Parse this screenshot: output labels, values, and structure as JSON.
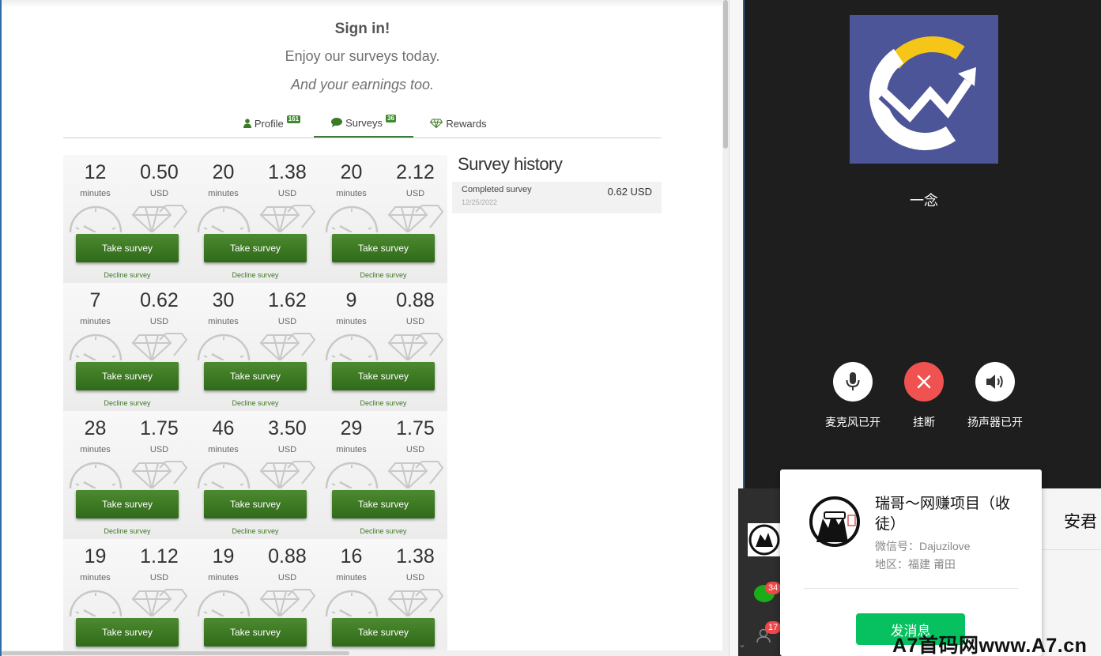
{
  "hero": {
    "title": "Sign in!",
    "line1": "Enjoy our surveys today.",
    "line2": "And your earnings too."
  },
  "tabs": [
    {
      "label": "Profile",
      "badge": "161",
      "icon": "user-icon"
    },
    {
      "label": "Surveys",
      "badge": "36",
      "icon": "chat-bubble-icon",
      "active": true
    },
    {
      "label": "Rewards",
      "badge": "",
      "icon": "diamond-icon"
    }
  ],
  "survey_labels": {
    "minutes": "minutes",
    "currency": "USD",
    "take": "Take survey",
    "decline": "Decline survey"
  },
  "surveys": [
    {
      "minutes": "12",
      "amount": "0.50"
    },
    {
      "minutes": "20",
      "amount": "1.38"
    },
    {
      "minutes": "20",
      "amount": "2.12"
    },
    {
      "minutes": "7",
      "amount": "0.62"
    },
    {
      "minutes": "30",
      "amount": "1.62"
    },
    {
      "minutes": "9",
      "amount": "0.88"
    },
    {
      "minutes": "28",
      "amount": "1.75"
    },
    {
      "minutes": "46",
      "amount": "3.50"
    },
    {
      "minutes": "29",
      "amount": "1.75"
    },
    {
      "minutes": "19",
      "amount": "1.12"
    },
    {
      "minutes": "19",
      "amount": "0.88"
    },
    {
      "minutes": "16",
      "amount": "1.38"
    }
  ],
  "history": {
    "title": "Survey history",
    "items": [
      {
        "label": "Completed survey",
        "date": "12/25/2022",
        "amount": "0.62 USD"
      }
    ]
  },
  "call": {
    "caller_name": "一念",
    "brand_color": "#4c5597",
    "accent_yellow": "#f5c518",
    "controls": [
      {
        "label": "麦克风已开",
        "icon": "microphone-icon"
      },
      {
        "label": "挂断",
        "icon": "hang-up-icon"
      },
      {
        "label": "扬声器已开",
        "icon": "speaker-icon"
      }
    ]
  },
  "chat": {
    "unread_messages": "34",
    "unread_contacts": "17",
    "chat_partner": "安君"
  },
  "contact_card": {
    "name": "瑞哥～网赚项目（收徒）",
    "wechat_label": "微信号：",
    "wechat_id": "Dajuzilove",
    "region_label": "地区：",
    "region": "福建 莆田",
    "send_button": "发消息"
  },
  "watermark": "A7首码网www.A7.cn"
}
